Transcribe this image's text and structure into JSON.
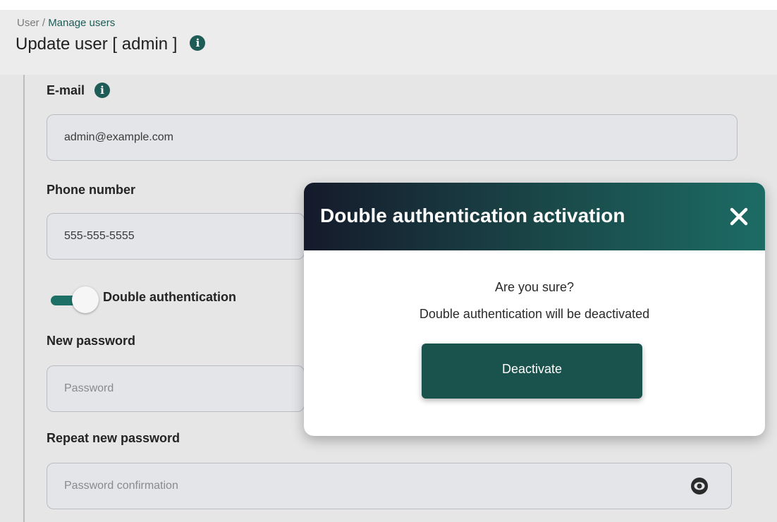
{
  "breadcrumb": {
    "root": "User",
    "separator": " / ",
    "current": "Manage users"
  },
  "page": {
    "title": "Update user [ admin ]",
    "info_icon": "info-icon"
  },
  "form": {
    "email": {
      "label": "E-mail",
      "info_icon": "info-icon",
      "value": "admin@example.com"
    },
    "phone": {
      "label": "Phone number",
      "value": "555-555-5555"
    },
    "double_auth": {
      "label": "Double authentication",
      "enabled": true
    },
    "new_password": {
      "label": "New password",
      "placeholder": "Password"
    },
    "repeat_password": {
      "label": "Repeat new password",
      "placeholder": "Password confirmation",
      "toggle_icon": "eye-icon"
    }
  },
  "modal": {
    "title": "Double authentication activation",
    "close_icon": "close-icon",
    "question": "Are you sure?",
    "message": "Double authentication will be deactivated",
    "confirm_label": "Deactivate"
  },
  "colors": {
    "accent": "#1d5c57",
    "toggle_on": "#1d7066",
    "header_gradient_start": "#151a2b",
    "header_gradient_end": "#1c6b64",
    "button": "#1a524d"
  }
}
